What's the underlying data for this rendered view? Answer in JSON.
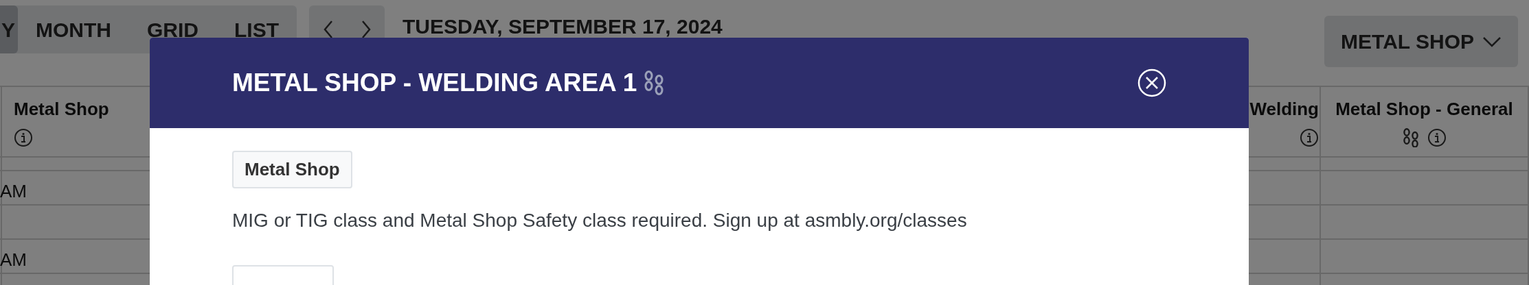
{
  "toolbar": {
    "views": [
      {
        "label": "Y",
        "selected": true
      },
      {
        "label": "MONTH",
        "selected": false
      },
      {
        "label": "GRID",
        "selected": false
      },
      {
        "label": "LIST",
        "selected": false
      }
    ],
    "date": "TUESDAY, SEPTEMBER 17, 2024",
    "location_menu": {
      "label": "METAL SHOP"
    }
  },
  "schedule": {
    "columns": [
      {
        "title": "Metal Shop",
        "chained": false
      },
      {
        "title": "Welding",
        "chained": false
      },
      {
        "title": "Metal Shop - General",
        "chained": true
      }
    ],
    "time_labels": [
      "AM",
      "AM"
    ]
  },
  "modal": {
    "title": "METAL SHOP - WELDING AREA 1",
    "chained": true,
    "tag": "Metal Shop",
    "description": "MIG or TIG class and Metal Shop Safety class required. Sign up at asmbly.org/classes"
  }
}
